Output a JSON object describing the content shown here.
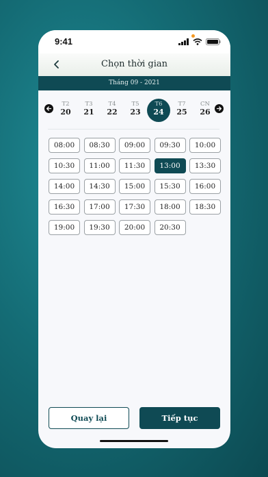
{
  "status": {
    "time": "9:41"
  },
  "header": {
    "title": "Chọn thời gian"
  },
  "month_label": "Tháng 09 - 2021",
  "days": [
    {
      "dow": "T2",
      "date": "20",
      "selected": false
    },
    {
      "dow": "T3",
      "date": "21",
      "selected": false
    },
    {
      "dow": "T4",
      "date": "22",
      "selected": false
    },
    {
      "dow": "T5",
      "date": "23",
      "selected": false
    },
    {
      "dow": "T6",
      "date": "24",
      "selected": true
    },
    {
      "dow": "T7",
      "date": "25",
      "selected": false
    },
    {
      "dow": "CN",
      "date": "26",
      "selected": false
    }
  ],
  "time_slots": [
    "08:00",
    "08:30",
    "09:00",
    "09:30",
    "10:00",
    "10:30",
    "11:00",
    "11:30",
    "13:00",
    "13:30",
    "14:00",
    "14:30",
    "15:00",
    "15:30",
    "16:00",
    "16:30",
    "17:00",
    "17:30",
    "18:00",
    "18:30",
    "19:00",
    "19:30",
    "20:00",
    "20:30"
  ],
  "selected_slot": "13:00",
  "buttons": {
    "back": "Quay lại",
    "next": "Tiếp tục"
  },
  "icons": {
    "back": "chevron-left-icon",
    "prev": "arrow-left-circle-icon",
    "next": "arrow-right-circle-icon"
  },
  "colors": {
    "primary": "#0f4a54",
    "background": "#146b74"
  }
}
